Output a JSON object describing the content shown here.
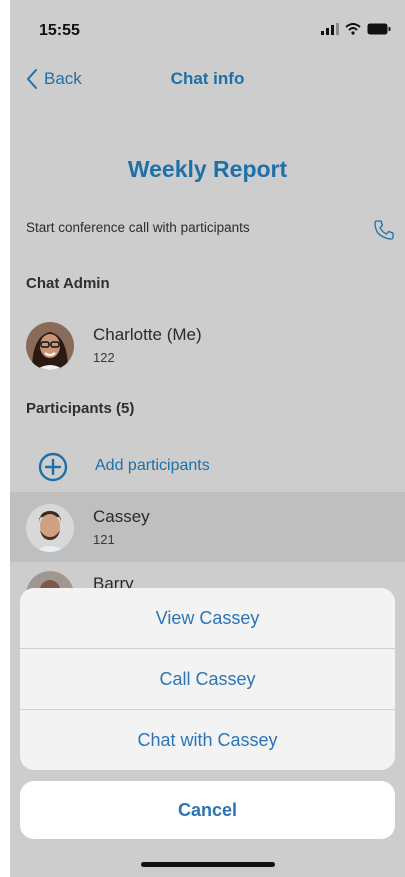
{
  "status_bar": {
    "time": "15:55"
  },
  "nav": {
    "back_label": "Back",
    "title": "Chat info"
  },
  "chat": {
    "title": "Weekly Report",
    "conference_call_text": "Start conference call with participants"
  },
  "admin_section": {
    "header": "Chat Admin",
    "admin": {
      "name": "Charlotte (Me)",
      "extension": "122"
    }
  },
  "participants_section": {
    "header": "Participants (5)",
    "add_label": "Add participants",
    "participants": [
      {
        "name": "Cassey",
        "extension": "121"
      },
      {
        "name": "Barry"
      }
    ]
  },
  "action_sheet": {
    "actions": [
      "View Cassey",
      "Call Cassey",
      "Chat with Cassey"
    ],
    "cancel_label": "Cancel"
  },
  "colors": {
    "accent": "#1e70a8",
    "sheet_action": "#2c74b5",
    "dim_background": "#cdcdcd"
  }
}
